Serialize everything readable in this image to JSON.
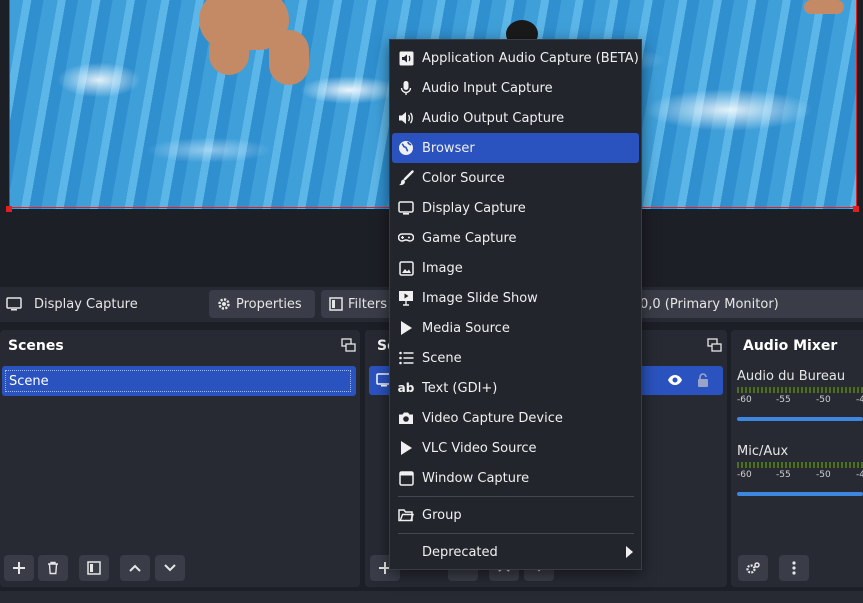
{
  "context_bar": {
    "source_name": "Display Capture",
    "properties_label": "Properties",
    "filters_label": "Filters",
    "display_select_value": "0,0 (Primary Monitor)"
  },
  "scenes_dock": {
    "title": "Scenes",
    "items": [
      "Scene"
    ]
  },
  "sources_dock": {
    "title_visible": "So"
  },
  "audio_mixer": {
    "title": "Audio Mixer",
    "channels": [
      {
        "name": "Audio du Bureau",
        "ticks": [
          "-60",
          "-55",
          "-50",
          "-4"
        ]
      },
      {
        "name": "Mic/Aux",
        "ticks": [
          "-60",
          "-55",
          "-50",
          "-4"
        ]
      }
    ]
  },
  "context_menu": {
    "items": [
      {
        "label": "Application Audio Capture (BETA)",
        "icon": "application-audio-icon"
      },
      {
        "label": "Audio Input Capture",
        "icon": "microphone-icon"
      },
      {
        "label": "Audio Output Capture",
        "icon": "speaker-icon"
      },
      {
        "label": "Browser",
        "icon": "globe-icon",
        "highlighted": true
      },
      {
        "label": "Color Source",
        "icon": "brush-icon"
      },
      {
        "label": "Display Capture",
        "icon": "monitor-icon"
      },
      {
        "label": "Game Capture",
        "icon": "gamepad-icon"
      },
      {
        "label": "Image",
        "icon": "image-icon"
      },
      {
        "label": "Image Slide Show",
        "icon": "slideshow-icon"
      },
      {
        "label": "Media Source",
        "icon": "play-icon"
      },
      {
        "label": "Scene",
        "icon": "list-icon"
      },
      {
        "label": "Text (GDI+)",
        "icon": "text-icon"
      },
      {
        "label": "Video Capture Device",
        "icon": "camera-icon"
      },
      {
        "label": "VLC Video Source",
        "icon": "play-icon"
      },
      {
        "label": "Window Capture",
        "icon": "window-icon"
      }
    ],
    "group_label": "Group",
    "deprecated_label": "Deprecated"
  }
}
